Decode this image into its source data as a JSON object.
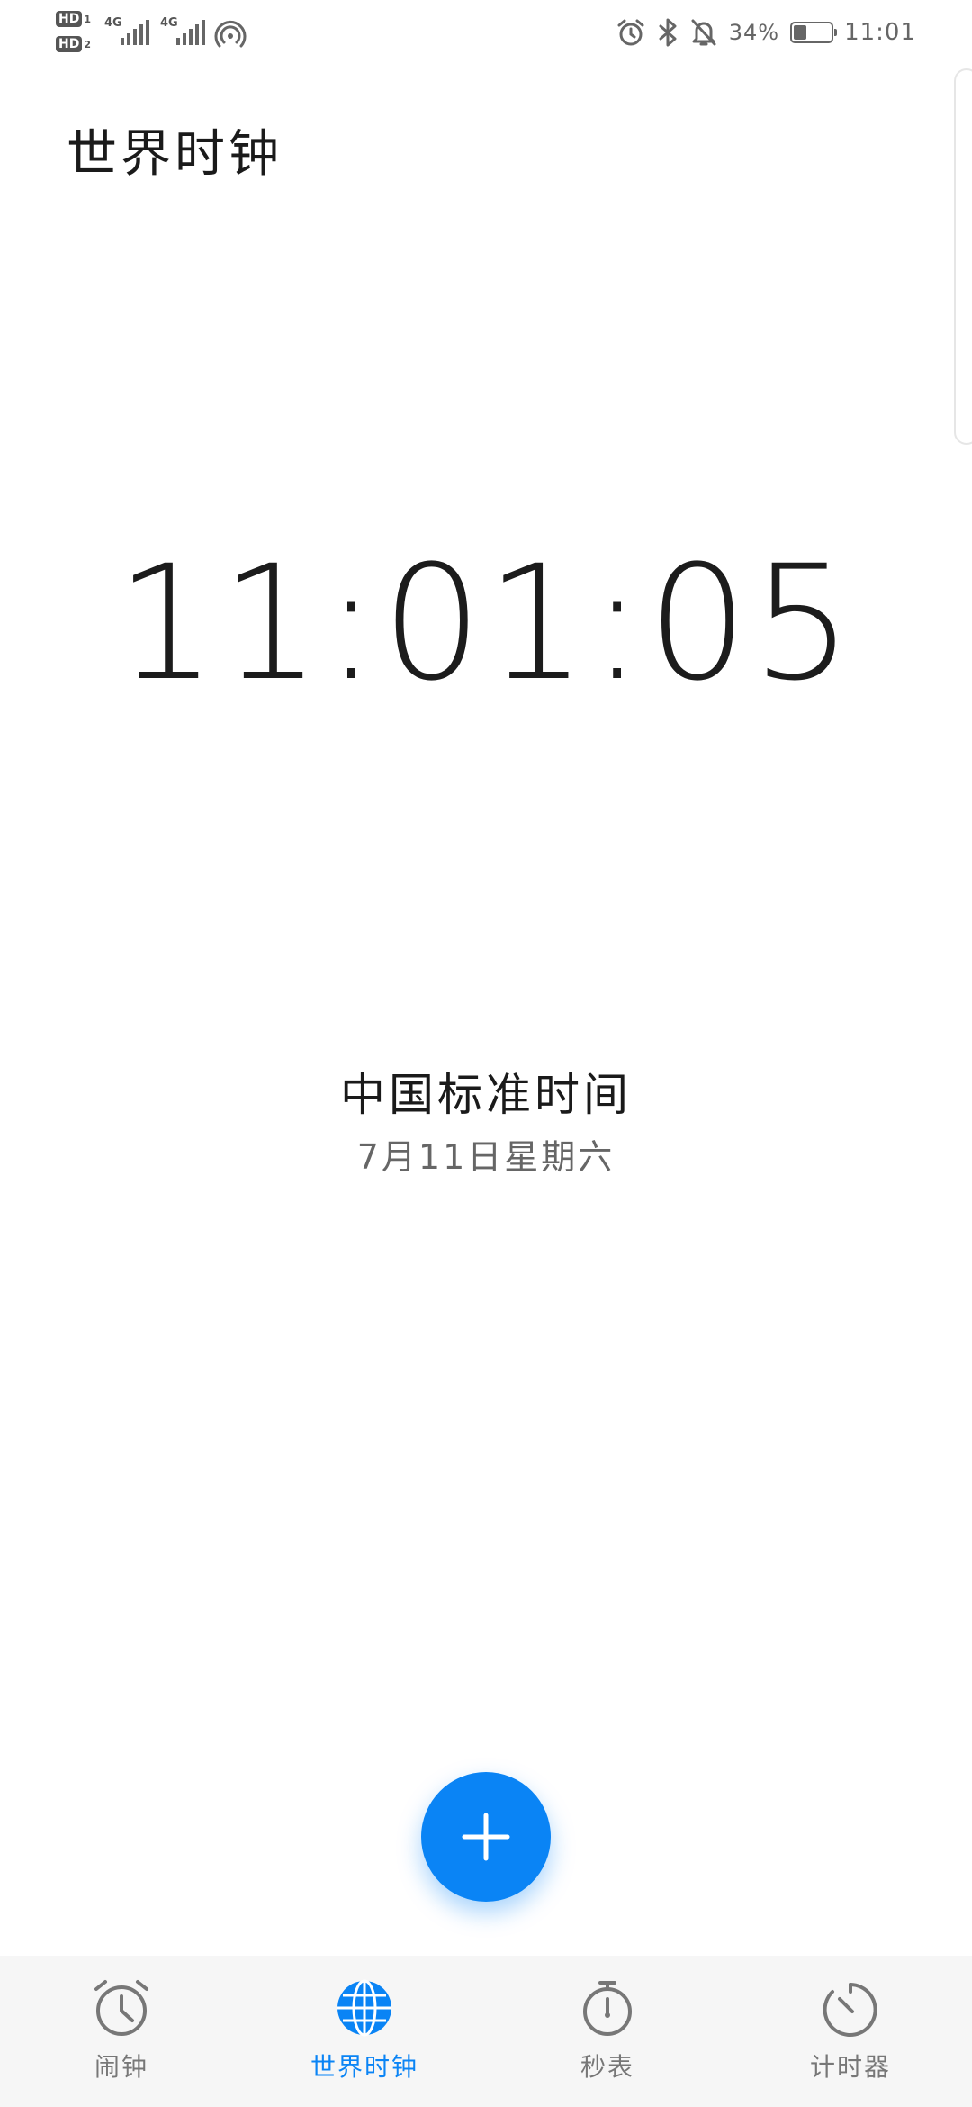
{
  "status_bar": {
    "sim1": {
      "badge": "HD",
      "index": "1",
      "network": "4G"
    },
    "sim2": {
      "badge": "HD",
      "index": "2",
      "network": "4G"
    },
    "battery_percent": "34%",
    "battery_level": 0.34,
    "time": "11:01",
    "icons": [
      "alarm-icon",
      "bluetooth-icon",
      "bell-muted-icon",
      "battery-icon",
      "hotspot-icon"
    ]
  },
  "header": {
    "title": "世界时钟"
  },
  "clock": {
    "time": "11:01:05",
    "zone_name": "中国标准时间",
    "date": "7月11日星期六"
  },
  "fab": {
    "icon": "plus-icon"
  },
  "bottom_nav": {
    "items": [
      {
        "label": "闹钟",
        "icon": "alarm-clock-icon",
        "active": false
      },
      {
        "label": "世界时钟",
        "icon": "globe-icon",
        "active": true
      },
      {
        "label": "秒表",
        "icon": "stopwatch-icon",
        "active": false
      },
      {
        "label": "计时器",
        "icon": "timer-icon",
        "active": false
      }
    ]
  },
  "colors": {
    "accent": "#0a84f5",
    "text_primary": "#1a1a1a",
    "text_secondary": "#666666",
    "nav_background": "#f6f6f6"
  }
}
